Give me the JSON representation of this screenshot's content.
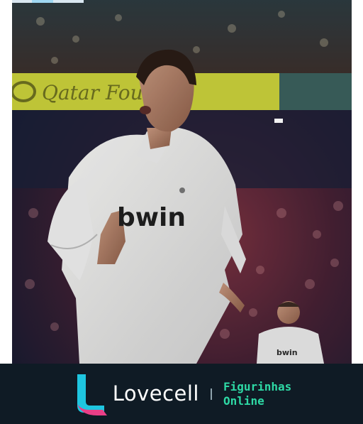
{
  "photo": {
    "description_icon": "soccer-player-photo",
    "ad_board_text": "Qatar Fou",
    "shirt_sponsor_text": "bwin"
  },
  "banner": {
    "brand": "Lovecell",
    "tagline_line1": "Figurinhas",
    "tagline_line2": "Online",
    "background_color": "#0f1b25",
    "accent_color": "#2ed9a5",
    "logo_colors": [
      "#1ec6e0",
      "#ea3f87"
    ]
  }
}
